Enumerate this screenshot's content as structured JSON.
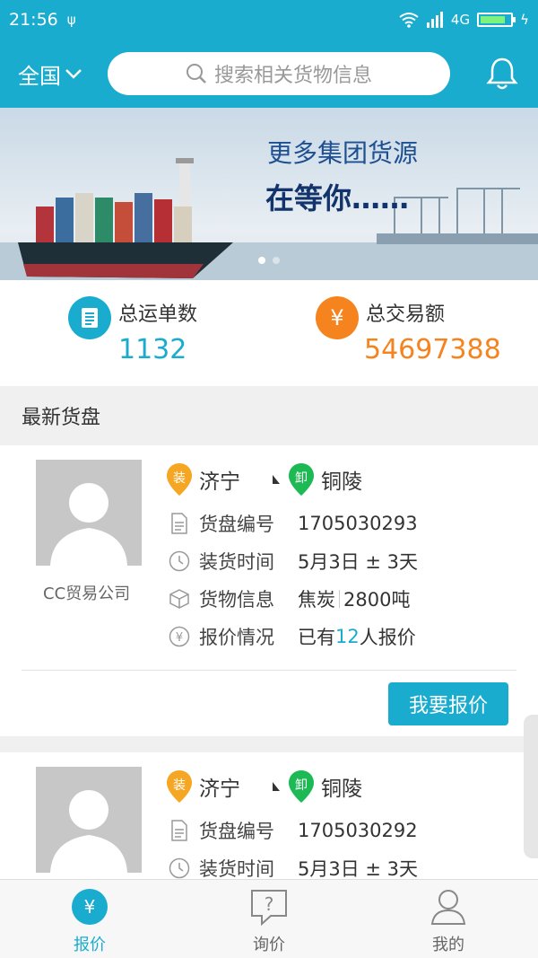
{
  "status_bar": {
    "time": "21:56",
    "network": "4G"
  },
  "header": {
    "region": "全国",
    "search_placeholder": "搜索相关货物信息"
  },
  "banner": {
    "line1": "更多集团货源",
    "line2": "在等你……"
  },
  "stats": [
    {
      "label": "总运单数",
      "value": "1132",
      "icon": "document-icon",
      "color": "#1aaccf"
    },
    {
      "label": "总交易额",
      "value": "54697388",
      "icon": "yen-icon",
      "color": "#f5841f"
    }
  ],
  "section_title": "最新货盘",
  "listings": [
    {
      "company": "CC贸易公司",
      "load_tag": "装",
      "unload_tag": "卸",
      "from": "济宁",
      "to": "铜陵",
      "id_label": "货盘编号",
      "id": "1705030293",
      "time_label": "装货时间",
      "time": "5月3日 ± 3天",
      "goods_label": "货物信息",
      "goods": "焦炭",
      "weight": "2800吨",
      "quote_label": "报价情况",
      "quote_prefix": "已有",
      "quote_count": "12",
      "quote_suffix": "人报价",
      "button": "我要报价"
    },
    {
      "load_tag": "装",
      "unload_tag": "卸",
      "from": "济宁",
      "to": "铜陵",
      "id_label": "货盘编号",
      "id": "1705030292",
      "time_label": "装货时间",
      "time": "5月3日 ± 3天"
    }
  ],
  "tabs": [
    {
      "label": "报价",
      "icon": "yen-circle-icon",
      "active": true
    },
    {
      "label": "询价",
      "icon": "question-bubble-icon",
      "active": false
    },
    {
      "label": "我的",
      "icon": "user-icon",
      "active": false
    }
  ],
  "colors": {
    "primary": "#1aaccf",
    "orange": "#f5841f",
    "load_pin": "#f5a623",
    "unload_pin": "#1db954"
  }
}
